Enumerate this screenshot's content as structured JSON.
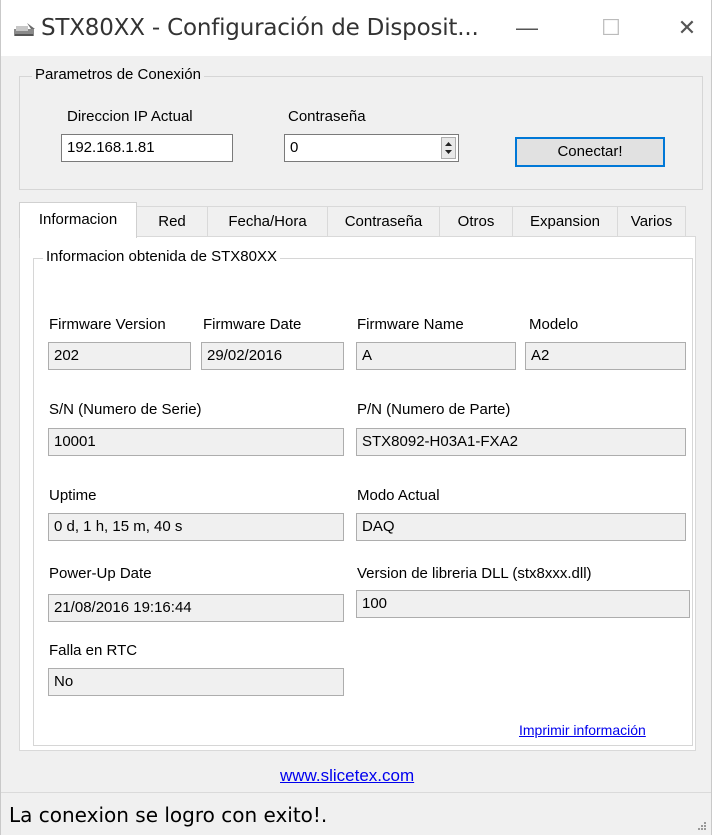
{
  "window": {
    "title": "STX80XX - Configuración de Disposit...",
    "minimize_glyph": "—",
    "maximize_glyph": "☐",
    "close_glyph": "✕"
  },
  "connection": {
    "group_label": "Parametros de Conexión",
    "ip_label": "Direccion IP Actual",
    "ip_value": "192.168.1.81",
    "password_label": "Contraseña",
    "password_value": "0",
    "connect_button": "Conectar!"
  },
  "tabs": [
    {
      "label": "Informacion",
      "active": true
    },
    {
      "label": "Red"
    },
    {
      "label": "Fecha/Hora"
    },
    {
      "label": "Contraseña"
    },
    {
      "label": "Otros"
    },
    {
      "label": "Expansion"
    },
    {
      "label": "Varios"
    }
  ],
  "info": {
    "group_label": "Informacion obtenida de STX80XX",
    "firmware_version_label": "Firmware Version",
    "firmware_version": "202",
    "firmware_date_label": "Firmware Date",
    "firmware_date": "29/02/2016",
    "firmware_name_label": "Firmware Name",
    "firmware_name": "A",
    "modelo_label": "Modelo",
    "modelo": "A2",
    "sn_label": "S/N (Numero de Serie)",
    "sn": "10001",
    "pn_label": "P/N (Numero de Parte)",
    "pn": "STX8092-H03A1-FXA2",
    "uptime_label": "Uptime",
    "uptime": "0 d, 1 h, 15 m, 40 s",
    "modo_label": "Modo Actual",
    "modo": "DAQ",
    "powerup_label": "Power-Up Date",
    "powerup": "21/08/2016 19:16:44",
    "dll_label": "Version de libreria DLL (stx8xxx.dll)",
    "dll": "100",
    "rtc_label": "Falla en RTC",
    "rtc": "No",
    "print_link": "Imprimir información"
  },
  "footer": {
    "website": "www.slicetex.com",
    "status": "La conexion se logro con exito!."
  },
  "colors": {
    "accent": "#0078d7",
    "link": "#0000ee",
    "window_bg": "#f0f0f0"
  }
}
